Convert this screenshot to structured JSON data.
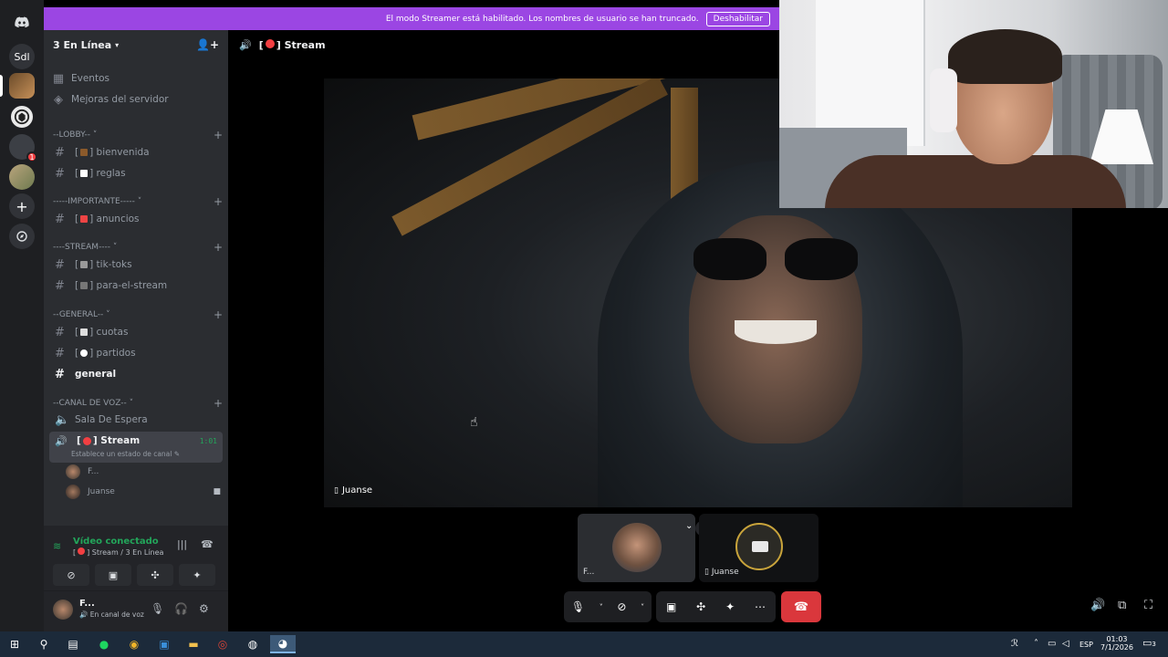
{
  "rail": {
    "server_initials": "Sdl",
    "notification_count": "1",
    "add_icon": "plus-icon",
    "explore_icon": "compass-icon"
  },
  "banner": {
    "message": "El modo Streamer está habilitado. Los nombres de usuario se han truncado.",
    "button_label": "Deshabilitar"
  },
  "server": {
    "name": "3 En Línea",
    "invite_icon": "add-member-icon"
  },
  "sidebar": {
    "top_items": [
      {
        "label": "Eventos",
        "icon": "calendar-icon"
      },
      {
        "label": "Mejoras del servidor",
        "icon": "boost-icon"
      }
    ],
    "categories": [
      {
        "label": "--LOBBY--",
        "channels": [
          "bienvenida",
          "reglas"
        ]
      },
      {
        "label": "-----IMPORTANTE-----",
        "channels": [
          "anuncios"
        ]
      },
      {
        "label": "----STREAM----",
        "channels": [
          "tik-toks",
          "para-el-stream"
        ]
      },
      {
        "label": "--GENERAL--",
        "channels": [
          "cuotas",
          "partidos",
          "general"
        ]
      },
      {
        "label": "--CANAL DE VOZ--",
        "channels": [
          "Sala De Espera",
          "Stream"
        ]
      }
    ],
    "active_voice": {
      "name": "Stream",
      "timer": "1:01",
      "status_hint": "Establece un estado de canal"
    },
    "voice_users": [
      "F...",
      "Juanse"
    ]
  },
  "voice_panel": {
    "status": "Vídeo conectado",
    "location": "Stream / 3 En Línea"
  },
  "user_panel": {
    "username": "F...",
    "status": "En canal de voz"
  },
  "stage": {
    "channel_name": "Stream",
    "main_video_label": "Juanse",
    "tiles": [
      {
        "label": "F..."
      },
      {
        "label": "Juanse"
      }
    ]
  },
  "taskbar": {
    "language": "ESP",
    "time": "01:03",
    "date": "7/1/2026",
    "notif_count": "3"
  },
  "colors": {
    "accent": "#9b46e3",
    "connected": "#23a55a",
    "hangup": "#da373c",
    "live_dot": "#f23f42"
  }
}
